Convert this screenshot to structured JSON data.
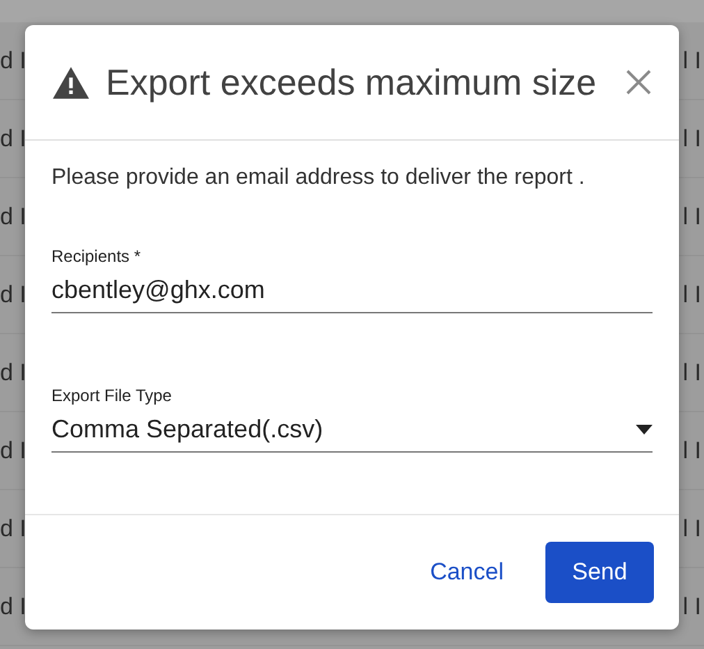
{
  "background_rows": [
    {
      "column_1": "d I",
      "column_2": "l I"
    },
    {
      "column_1": "d I",
      "column_2": "l I"
    },
    {
      "column_1": "d I",
      "column_2": "l I"
    },
    {
      "column_1": "d I",
      "column_2": "l I"
    },
    {
      "column_1": "d I",
      "column_2": "l I"
    },
    {
      "column_1": "d I",
      "column_2": "l I"
    },
    {
      "column_1": "d I",
      "column_2": "l I"
    },
    {
      "column_1": "d I",
      "column_2": "l I"
    }
  ],
  "dialog": {
    "title": "Export exceeds maximum size",
    "message": "Please provide an email address to deliver the report .",
    "fields": [
      {
        "kind": "text",
        "label": "Recipients *",
        "value": "cbentley@ghx.com"
      },
      {
        "kind": "select",
        "label": "Export File Type",
        "value": "Comma Separated(.csv)"
      }
    ],
    "buttons": [
      {
        "kind": "text",
        "label": "Cancel"
      },
      {
        "kind": "primary",
        "label": "Send"
      }
    ]
  }
}
